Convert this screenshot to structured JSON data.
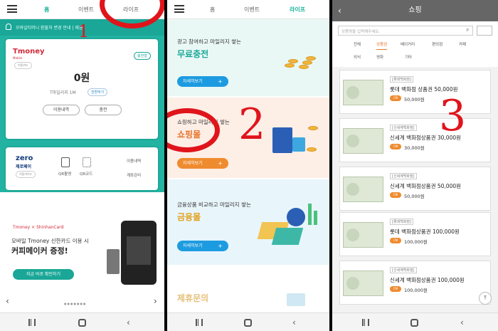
{
  "panel1": {
    "tabs": [
      "홈",
      "이벤트",
      "라이프"
    ],
    "notice": "모바일티머니 환불처 변경 안내 | 제공",
    "tmoney_logo": "Tmoney",
    "tmoney_sub": "Mobile",
    "small_pill": "이용카드",
    "charge_pill": "충전형",
    "balance": "0원",
    "mileage": "T마일리지 1M",
    "convert_pill": "전환하기",
    "history_btn": "이용내역",
    "charge_btn": "충전",
    "zero_logo": "zero",
    "zero_sub": "제로페이",
    "zero_pill": "이용가이드",
    "qr_scan": "QR촬영",
    "qr_code": "QR코드",
    "usage": "이용내역",
    "account": "계좌관리",
    "banner_brand": "Tmoney × ShinhanCard",
    "banner_line1": "모바일 Tmoney 신한카드 이용 시",
    "banner_line2": "커피메이커 증정!",
    "banner_btn": "지금 바로 확인하기",
    "label_num": "1"
  },
  "panel2": {
    "tabs": [
      "홈",
      "이벤트",
      "라이프"
    ],
    "sec1_t1": "광고 참여하고 마일리지 쌓는",
    "sec1_t2": "무료충전",
    "sec1_btn": "자세히보기",
    "sec2_t1": "쇼핑하고 마일리지 쌓는",
    "sec2_t2": "쇼핑몰",
    "sec2_btn": "자세히보기",
    "sec3_t1": "금융상품 비교하고 마일리지 쌓는",
    "sec3_t2": "금융몰",
    "sec3_btn": "자세히보기",
    "sec4_t2": "제휴문의",
    "label_num": "2"
  },
  "panel3": {
    "title": "쇼핑",
    "search_placeholder": "상품명을 입력해주세요.",
    "cats_row1": [
      "전체",
      "상품권",
      "베이커리",
      "편의점",
      "카페"
    ],
    "cats_row2": [
      "외식",
      "영화",
      "기타"
    ],
    "items": [
      {
        "store": "[롯데백화점]",
        "name": "롯데 백화점 상품권 50,000원",
        "price": "50,000원"
      },
      {
        "store": "[신세계백화점]",
        "name": "신세계 백화점상품권 30,000원",
        "price": "30,000원"
      },
      {
        "store": "[신세계백화점]",
        "name": "신세계 백화점상품권 50,000원",
        "price": "50,000원"
      },
      {
        "store": "[롯데백화점]",
        "name": "롯데 백화점상품권 100,000원",
        "price": "100,000원"
      },
      {
        "store": "[신세계백화점]",
        "name": "신세계 백화점상품권 100,000원",
        "price": "100,000원"
      }
    ],
    "coin_label": "CM",
    "label_num": "3"
  },
  "colors": {
    "teal": "#22b3a2",
    "red_annotation": "#e0141b",
    "orange": "#ef8b2f",
    "blue_btn": "#1d9be0"
  }
}
